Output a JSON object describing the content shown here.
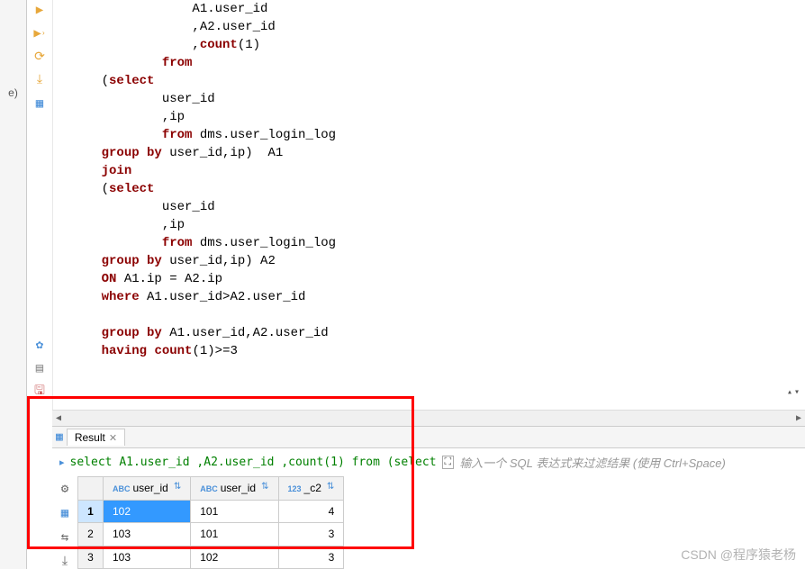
{
  "left_sidebar": {
    "label_e": "e)"
  },
  "editor": {
    "lines": [
      {
        "indent": 16,
        "parts": [
          {
            "t": "A1.user_id"
          }
        ]
      },
      {
        "indent": 16,
        "parts": [
          {
            "t": ",A2.user_id"
          }
        ]
      },
      {
        "indent": 16,
        "parts": [
          {
            "t": ","
          },
          {
            "t": "count",
            "c": "func"
          },
          {
            "t": "("
          },
          {
            "t": "1",
            "c": "num"
          },
          {
            "t": ")"
          }
        ]
      },
      {
        "indent": 12,
        "parts": [
          {
            "t": "from",
            "c": "kw"
          }
        ]
      },
      {
        "indent": 4,
        "parts": [
          {
            "t": "("
          },
          {
            "t": "select",
            "c": "kw"
          }
        ]
      },
      {
        "indent": 12,
        "parts": [
          {
            "t": "user_id"
          }
        ]
      },
      {
        "indent": 12,
        "parts": [
          {
            "t": ",ip"
          }
        ]
      },
      {
        "indent": 12,
        "parts": [
          {
            "t": "from",
            "c": "kw"
          },
          {
            "t": " dms.user_login_log"
          }
        ]
      },
      {
        "indent": 4,
        "parts": [
          {
            "t": "group by",
            "c": "kw"
          },
          {
            "t": " user_id,ip)  A1"
          }
        ]
      },
      {
        "indent": 4,
        "parts": [
          {
            "t": "join",
            "c": "kw"
          }
        ]
      },
      {
        "indent": 4,
        "parts": [
          {
            "t": "("
          },
          {
            "t": "select",
            "c": "kw"
          }
        ]
      },
      {
        "indent": 12,
        "parts": [
          {
            "t": "user_id"
          }
        ]
      },
      {
        "indent": 12,
        "parts": [
          {
            "t": ",ip"
          }
        ]
      },
      {
        "indent": 12,
        "parts": [
          {
            "t": "from",
            "c": "kw"
          },
          {
            "t": " dms.user_login_log"
          }
        ]
      },
      {
        "indent": 4,
        "parts": [
          {
            "t": "group by",
            "c": "kw"
          },
          {
            "t": " user_id,ip) A2"
          }
        ]
      },
      {
        "indent": 4,
        "parts": [
          {
            "t": "ON",
            "c": "kw"
          },
          {
            "t": " A1.ip = A2.ip"
          }
        ]
      },
      {
        "indent": 4,
        "parts": [
          {
            "t": "where",
            "c": "kw"
          },
          {
            "t": " A1.user_id>A2.user_id"
          }
        ]
      },
      {
        "indent": 0,
        "parts": []
      },
      {
        "indent": 4,
        "parts": [
          {
            "t": "group by",
            "c": "kw"
          },
          {
            "t": " A1.user_id,A2.user_id"
          }
        ]
      },
      {
        "indent": 4,
        "parts": [
          {
            "t": "having",
            "c": "kw"
          },
          {
            "t": " "
          },
          {
            "t": "count",
            "c": "func"
          },
          {
            "t": "("
          },
          {
            "t": "1",
            "c": "num"
          },
          {
            "t": ")>="
          },
          {
            "t": "3",
            "c": "num"
          }
        ]
      }
    ]
  },
  "result": {
    "tab_label": "Result",
    "query_preview": "select A1.user_id ,A2.user_id ,count(1) from (select",
    "filter_placeholder": "输入一个 SQL 表达式来过滤结果 (使用 Ctrl+Space)",
    "columns": [
      {
        "name": "user_id",
        "typeicon": "ABC"
      },
      {
        "name": "user_id",
        "typeicon": "ABC"
      },
      {
        "name": "_c2",
        "typeicon": "123"
      }
    ],
    "rows": [
      {
        "n": "1",
        "cells": [
          "102",
          "101",
          "4"
        ],
        "selected": true
      },
      {
        "n": "2",
        "cells": [
          "103",
          "101",
          "3"
        ]
      },
      {
        "n": "3",
        "cells": [
          "103",
          "102",
          "3"
        ]
      }
    ]
  },
  "watermark": "CSDN @程序猿老杨",
  "colors": {
    "keyword": "#8b0000",
    "query_green": "#008000",
    "type_icon": "#4a90d9",
    "selected": "#3399ff"
  }
}
